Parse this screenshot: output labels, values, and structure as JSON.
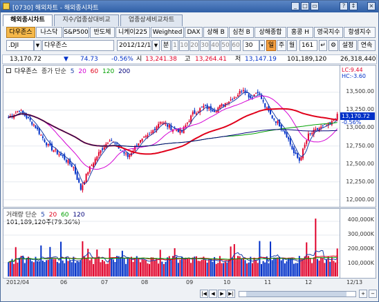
{
  "window": {
    "title": "[0730] 해외차트 - 해외종시차트",
    "buttons": [
      "_",
      "□",
      "×",
      "?",
      "▭",
      "↕"
    ]
  },
  "tabs": [
    "해외종시차트",
    "지수/업종상대비교",
    "업종상세비교차트"
  ],
  "toolbar1": {
    "buttons": [
      "다우존스",
      "나스닥",
      "S&P500",
      "반도체",
      "니케이225",
      "Weighted",
      "DAX",
      "상해 B",
      "심천 B",
      "상해종합",
      "홍콩 H",
      "영국지수",
      "항셍지수"
    ],
    "selected": "다우존스"
  },
  "toolbar2": {
    "symbol": ".DJI",
    "name": "다우존스",
    "date": "2012/12/14",
    "mode_button": "분",
    "periods": [
      "1",
      "10",
      "20",
      "30",
      "40",
      "50",
      "60"
    ],
    "count_value": "30",
    "day_btn": "일",
    "week_btn": "주",
    "month_btn": "월",
    "n_value": "161",
    "settings_label": "설정",
    "continuous_label": "연속"
  },
  "info": {
    "price": "13,170.72",
    "change_arrow": "▼",
    "change": "74.73",
    "change_pct": "-0.56%",
    "open_label": "시",
    "open": "13,241.38",
    "high_label": "고",
    "high": "13,264.41",
    "low_label": "저",
    "low": "13,147.19",
    "volume": "101,189,120",
    "amount": "26,318,440"
  },
  "price_panel": {
    "legend": {
      "series": "종가 단순",
      "ma": [
        "5",
        "20",
        "60",
        "120",
        "200"
      ]
    },
    "ma_colors": [
      "#1a3fa8",
      "#d400d4",
      "#e0001a",
      "#00a000",
      "#00007a"
    ],
    "lc": "LC:9.44",
    "hc": "HC:-3.60",
    "current_tag": "13,170.72",
    "pct_tag": "-0.56%",
    "yticks": [
      "13,500.00",
      "13,250.00",
      "13,000.00",
      "12,750.00",
      "12,500.00",
      "12,250.00",
      "12,000.00"
    ]
  },
  "volume_panel": {
    "legend": {
      "series": "거래량 단순",
      "ma": [
        "5",
        "20",
        "60",
        "120"
      ]
    },
    "value_text": "101,189,120주(79.36%)",
    "yticks": [
      "400,000K",
      "300,000K",
      "200,000K",
      "100,000K"
    ]
  },
  "xticks": [
    "2012/04",
    "06",
    "07",
    "08",
    "09",
    "10",
    "11",
    "12",
    "12/13"
  ],
  "colors": {
    "up": "#e0002a",
    "down": "#0030c8",
    "accent": "#f5b84a"
  }
}
